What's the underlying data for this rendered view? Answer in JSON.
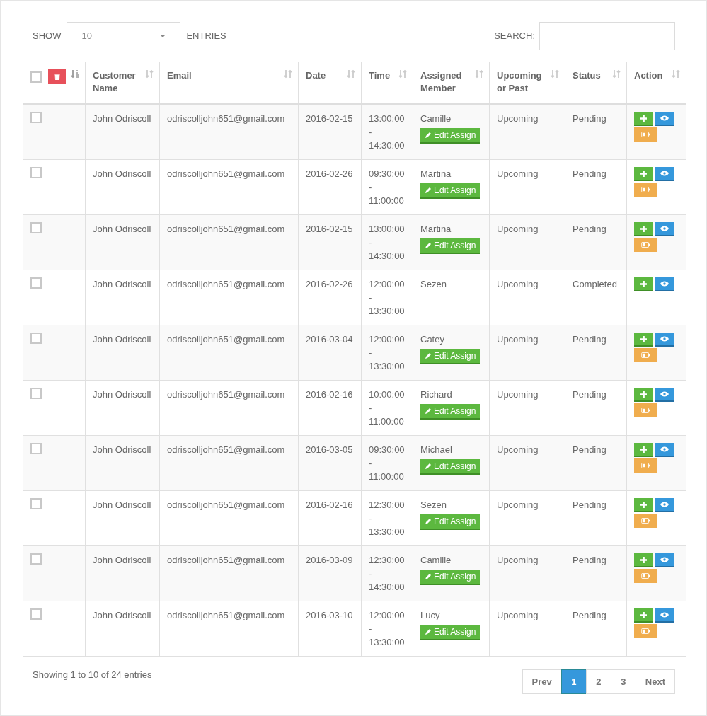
{
  "length": {
    "label_before": "SHOW",
    "value": "10",
    "label_after": "ENTRIES"
  },
  "search": {
    "label": "SEARCH:"
  },
  "table": {
    "select_all": {
      "checked": false
    },
    "columns": [
      {
        "label": "Customer Name"
      },
      {
        "label": "Email"
      },
      {
        "label": "Date"
      },
      {
        "label": "Time"
      },
      {
        "label": "Assigned Member"
      },
      {
        "label": "Upcoming or Past"
      },
      {
        "label": "Status"
      },
      {
        "label": "Action"
      }
    ],
    "rows": [
      {
        "checked": false,
        "name": "John Odriscoll",
        "email": "odriscolljohn651@gmail.com",
        "date": "2016-02-15",
        "time": "13:00:00 - 14:30:00",
        "member": "Camille",
        "edit_label": "Edit Assign",
        "timing": "Upcoming",
        "status": "Pending",
        "actions": [
          {
            "kind": "add"
          },
          {
            "kind": "view"
          },
          {
            "kind": "toggle"
          }
        ]
      },
      {
        "checked": false,
        "name": "John Odriscoll",
        "email": "odriscolljohn651@gmail.com",
        "date": "2016-02-26",
        "time": "09:30:00 - 11:00:00",
        "member": "Martina",
        "edit_label": "Edit Assign",
        "timing": "Upcoming",
        "status": "Pending",
        "actions": [
          {
            "kind": "add"
          },
          {
            "kind": "view"
          },
          {
            "kind": "toggle"
          }
        ]
      },
      {
        "checked": false,
        "name": "John Odriscoll",
        "email": "odriscolljohn651@gmail.com",
        "date": "2016-02-15",
        "time": "13:00:00 - 14:30:00",
        "member": "Martina",
        "edit_label": "Edit Assign",
        "timing": "Upcoming",
        "status": "Pending",
        "actions": [
          {
            "kind": "add"
          },
          {
            "kind": "view"
          },
          {
            "kind": "toggle"
          }
        ]
      },
      {
        "checked": false,
        "name": "John Odriscoll",
        "email": "odriscolljohn651@gmail.com",
        "date": "2016-02-26",
        "time": "12:00:00 - 13:30:00",
        "member": "Sezen",
        "timing": "Upcoming",
        "status": "Completed",
        "actions": [
          {
            "kind": "add"
          },
          {
            "kind": "view"
          }
        ]
      },
      {
        "checked": false,
        "name": "John Odriscoll",
        "email": "odriscolljohn651@gmail.com",
        "date": "2016-03-04",
        "time": "12:00:00 - 13:30:00",
        "member": "Catey",
        "edit_label": "Edit Assign",
        "timing": "Upcoming",
        "status": "Pending",
        "actions": [
          {
            "kind": "add"
          },
          {
            "kind": "view"
          },
          {
            "kind": "toggle"
          }
        ]
      },
      {
        "checked": false,
        "name": "John Odriscoll",
        "email": "odriscolljohn651@gmail.com",
        "date": "2016-02-16",
        "time": "10:00:00 - 11:00:00",
        "member": "Richard",
        "edit_label": "Edit Assign",
        "timing": "Upcoming",
        "status": "Pending",
        "actions": [
          {
            "kind": "add"
          },
          {
            "kind": "view"
          },
          {
            "kind": "toggle"
          }
        ]
      },
      {
        "checked": false,
        "name": "John Odriscoll",
        "email": "odriscolljohn651@gmail.com",
        "date": "2016-03-05",
        "time": "09:30:00 - 11:00:00",
        "member": "Michael",
        "edit_label": "Edit Assign",
        "timing": "Upcoming",
        "status": "Pending",
        "actions": [
          {
            "kind": "add"
          },
          {
            "kind": "view"
          },
          {
            "kind": "toggle"
          }
        ]
      },
      {
        "checked": false,
        "name": "John Odriscoll",
        "email": "odriscolljohn651@gmail.com",
        "date": "2016-02-16",
        "time": "12:30:00 - 13:30:00",
        "member": "Sezen",
        "edit_label": "Edit Assign",
        "timing": "Upcoming",
        "status": "Pending",
        "actions": [
          {
            "kind": "add"
          },
          {
            "kind": "view"
          },
          {
            "kind": "toggle"
          }
        ]
      },
      {
        "checked": false,
        "name": "John Odriscoll",
        "email": "odriscolljohn651@gmail.com",
        "date": "2016-03-09",
        "time": "12:30:00 - 14:30:00",
        "member": "Camille",
        "edit_label": "Edit Assign",
        "timing": "Upcoming",
        "status": "Pending",
        "actions": [
          {
            "kind": "add"
          },
          {
            "kind": "view"
          },
          {
            "kind": "toggle"
          }
        ]
      },
      {
        "checked": false,
        "name": "John Odriscoll",
        "email": "odriscolljohn651@gmail.com",
        "date": "2016-03-10",
        "time": "12:00:00 - 13:30:00",
        "member": "Lucy",
        "edit_label": "Edit Assign",
        "timing": "Upcoming",
        "status": "Pending",
        "actions": [
          {
            "kind": "add"
          },
          {
            "kind": "view"
          },
          {
            "kind": "toggle"
          }
        ]
      }
    ]
  },
  "info": "Showing 1 to 10 of 24 entries",
  "pagination": [
    {
      "label": "Prev",
      "selected": false
    },
    {
      "label": "1",
      "selected": true
    },
    {
      "label": "2",
      "selected": false
    },
    {
      "label": "3",
      "selected": false
    },
    {
      "label": "Next",
      "selected": false
    }
  ]
}
